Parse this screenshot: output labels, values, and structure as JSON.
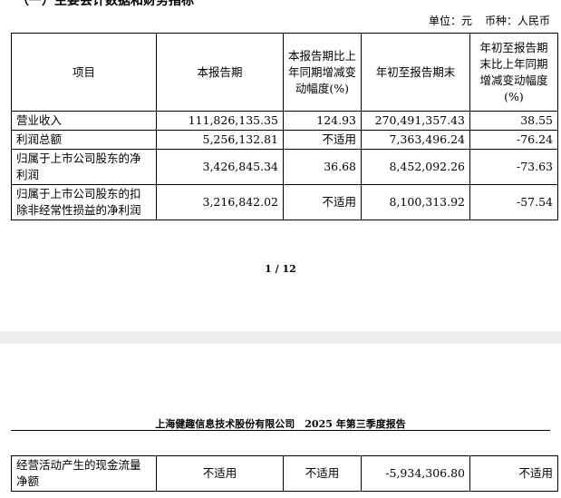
{
  "section_heading": "（一）主要会计数据和财务指标",
  "unit": {
    "currency_unit": "单位：元",
    "currency_type": "币种：人民币"
  },
  "table": {
    "headers": [
      "项目",
      "本报告期",
      "本报告期比上年同期增减变动幅度(%)",
      "年初至报告期末",
      "年初至报告期末比上年同期增减变动幅度(%)"
    ],
    "rows": [
      {
        "item": "营业收入",
        "current": "111,826,135.35",
        "current_change": "124.93",
        "ytd": "270,491,357.43",
        "ytd_change": "38.55"
      },
      {
        "item": "利润总额",
        "current": "5,256,132.81",
        "current_change": "不适用",
        "ytd": "7,363,496.24",
        "ytd_change": "-76.24"
      },
      {
        "item": "归属于上市公司股东的净利润",
        "current": "3,426,845.34",
        "current_change": "36.68",
        "ytd": "8,452,092.26",
        "ytd_change": "-73.63"
      },
      {
        "item": "归属于上市公司股东的扣除非经常性损益的净利润",
        "current": "3,216,842.02",
        "current_change": "不适用",
        "ytd": "8,100,313.92",
        "ytd_change": "-57.54"
      }
    ]
  },
  "page_number": "1 / 12",
  "report_header": "上海健趣信息技术股份有限公司　2025 年第三季度报告",
  "table2": {
    "rows": [
      {
        "item": "经营活动产生的现金流量净额",
        "current": "不适用",
        "current_change": "不适用",
        "ytd": "-5,934,306.80",
        "ytd_change": "不适用"
      }
    ]
  }
}
